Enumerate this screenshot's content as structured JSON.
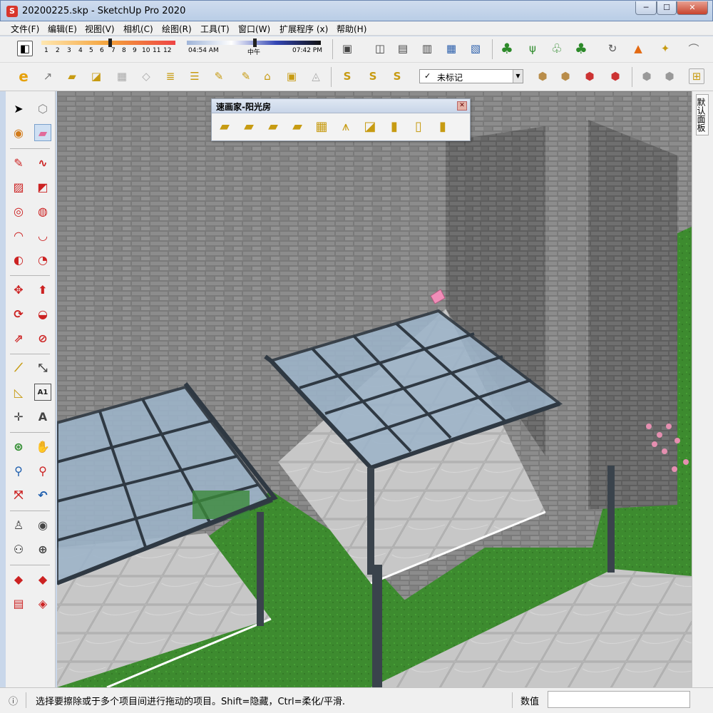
{
  "window": {
    "title": "20200225.skp - SketchUp Pro 2020",
    "minimize": "─",
    "maximize": "☐",
    "close": "✕"
  },
  "menu": [
    "文件(F)",
    "编辑(E)",
    "视图(V)",
    "相机(C)",
    "绘图(R)",
    "工具(T)",
    "窗口(W)",
    "扩展程序 (x)",
    "帮助(H)"
  ],
  "shadow": {
    "month_ticks": [
      "1",
      "2",
      "3",
      "4",
      "5",
      "6",
      "7",
      "8",
      "9",
      "10",
      "11",
      "12"
    ],
    "time_start": "04:54 AM",
    "time_mid": "中午",
    "time_end": "07:42 PM"
  },
  "tag_selector": {
    "value": "未标记",
    "check": "✓",
    "arrow": "▼"
  },
  "float_panel": {
    "title": "速画家-阳光房",
    "close": "✕"
  },
  "right_panel": {
    "tab": "默认面板"
  },
  "status": {
    "info_icon": "ⓘ",
    "message": "选择要擦除或于多个项目间进行拖动的项目。Shift=隐藏，Ctrl=柔化/平滑.",
    "measure_label": "数值",
    "measure_value": ""
  },
  "colors": {
    "accent": "#d8362b",
    "brick": "#7c7c7c",
    "glass": "#9bb4c8",
    "frame": "#2f3943",
    "grass": "#3c8c2e",
    "gold": "#c79b12"
  }
}
